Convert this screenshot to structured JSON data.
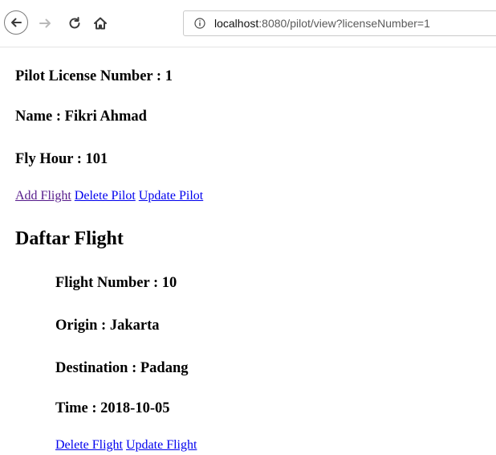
{
  "browser": {
    "url_host": "localhost",
    "url_rest": ":8080/pilot/view?licenseNumber=1"
  },
  "pilot": {
    "license_line": "Pilot License Number : 1",
    "name_line": "Name : Fikri Ahmad",
    "fly_hour_line": "Fly Hour : 101",
    "links": {
      "add_flight": "Add Flight",
      "delete_pilot": "Delete Pilot",
      "update_pilot": "Update Pilot"
    }
  },
  "flights_section": {
    "title": "Daftar Flight",
    "flights": [
      {
        "number_line": "Flight Number : 10",
        "origin_line": "Origin : Jakarta",
        "destination_line": "Destination : Padang",
        "time_line": "Time : 2018-10-05",
        "delete_label": "Delete Flight",
        "update_label": "Update Flight"
      }
    ]
  }
}
